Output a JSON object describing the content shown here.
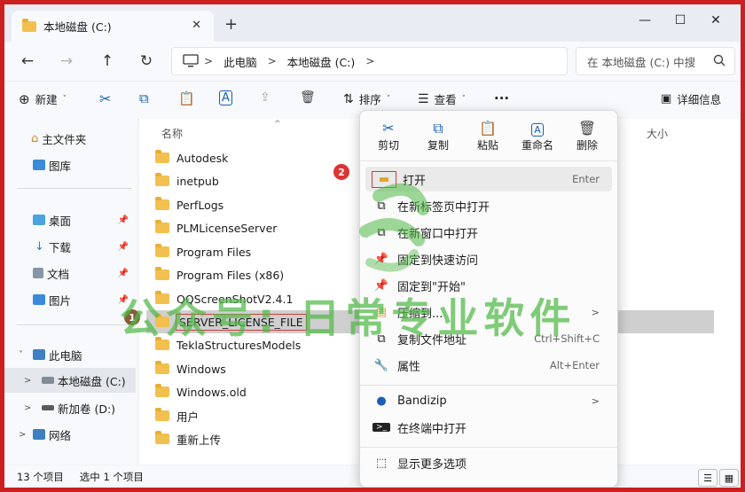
{
  "window": {
    "tab_title": "本地磁盘 (C:)",
    "tab_close": "✕",
    "new_tab": "+",
    "controls": {
      "minimize": "—",
      "maximize": "☐",
      "close": "✕"
    }
  },
  "address": {
    "back": "←",
    "forward": "→",
    "up": "↑",
    "refresh": "↻",
    "crumbs": [
      "此电脑",
      "本地磁盘 (C:)"
    ],
    "search_placeholder": "在 本地磁盘 (C:) 中搜"
  },
  "toolbar": {
    "new_label": "新建",
    "sort_label": "排序",
    "view_label": "查看",
    "more": "···",
    "details_label": "详细信息"
  },
  "sidebar": {
    "items": [
      {
        "label": "主文件夹"
      },
      {
        "label": "图库"
      },
      {
        "label": "桌面"
      },
      {
        "label": "下载"
      },
      {
        "label": "文档"
      },
      {
        "label": "图片"
      },
      {
        "label": "此电脑"
      },
      {
        "label": "本地磁盘 (C:)"
      },
      {
        "label": "新加卷 (D:)"
      },
      {
        "label": "网络"
      }
    ]
  },
  "content": {
    "columns": {
      "name": "名称",
      "size": "大小"
    },
    "files": [
      {
        "name": "Autodesk"
      },
      {
        "name": "inetpub"
      },
      {
        "name": "PerfLogs"
      },
      {
        "name": "PLMLicenseServer"
      },
      {
        "name": "Program Files"
      },
      {
        "name": "Program Files (x86)"
      },
      {
        "name": "QQScreenShotV2.4.1"
      },
      {
        "name": "SERVER_LICENSE_FILE"
      },
      {
        "name": "TeklaStructuresModels"
      },
      {
        "name": "Windows"
      },
      {
        "name": "Windows.old"
      },
      {
        "name": "用户"
      },
      {
        "name": "重新上传"
      }
    ],
    "selected_index": 7
  },
  "status": {
    "count": "13 个项目",
    "selection": "选中 1 个项目"
  },
  "context_menu": {
    "actions": [
      {
        "label": "剪切",
        "icon": "cut-icon"
      },
      {
        "label": "复制",
        "icon": "copy-icon"
      },
      {
        "label": "粘贴",
        "icon": "paste-icon"
      },
      {
        "label": "重命名",
        "icon": "rename-icon"
      },
      {
        "label": "删除",
        "icon": "delete-icon"
      }
    ],
    "items": [
      {
        "label": "打开",
        "shortcut": "Enter"
      },
      {
        "label": "在新标签页中打开",
        "shortcut": ""
      },
      {
        "label": "在新窗口中打开",
        "shortcut": ""
      },
      {
        "label": "固定到快速访问",
        "shortcut": ""
      },
      {
        "label": "固定到\"开始\"",
        "shortcut": ""
      },
      {
        "label": "压缩到...",
        "shortcut": ""
      },
      {
        "label": "复制文件地址",
        "shortcut": "Ctrl+Shift+C"
      },
      {
        "label": "属性",
        "shortcut": "Alt+Enter"
      },
      {
        "label": "Bandizip",
        "shortcut": ""
      },
      {
        "label": "在终端中打开",
        "shortcut": ""
      },
      {
        "label": "显示更多选项",
        "shortcut": ""
      }
    ]
  },
  "annotations": {
    "badge_1": "1",
    "badge_2": "2"
  },
  "watermark": {
    "text": "公众号: 日常专业软件"
  },
  "colors": {
    "frame": "#cc1f1f",
    "selection": "#cfcfcf",
    "accent": "#1a5fb4",
    "watermark": "#50b946"
  }
}
